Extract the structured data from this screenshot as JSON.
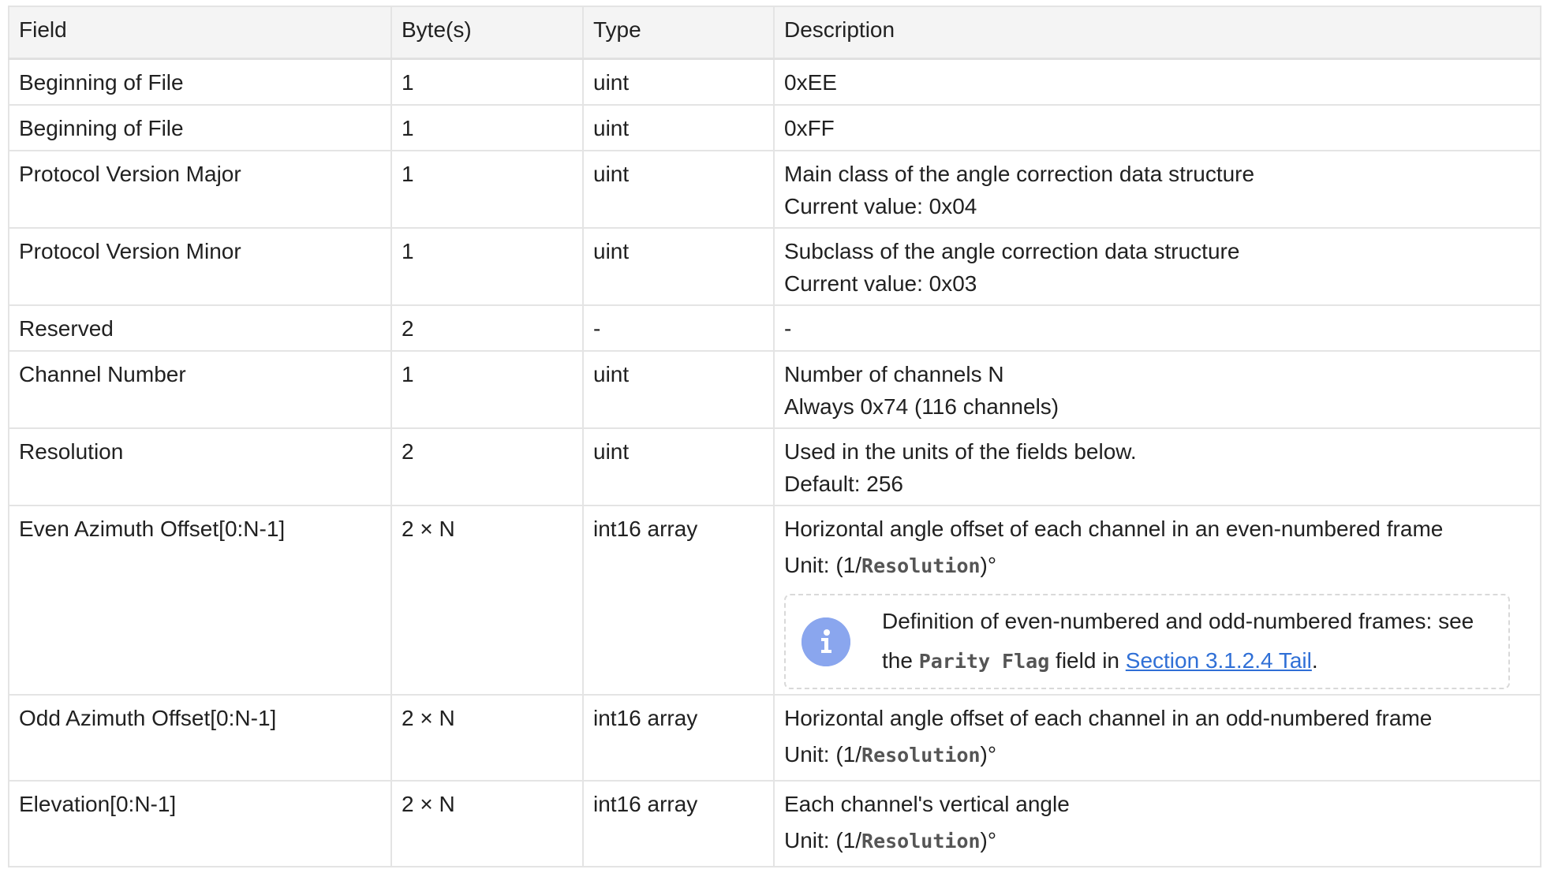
{
  "table": {
    "headers": [
      "Field",
      "Byte(s)",
      "Type",
      "Description"
    ],
    "rows": [
      {
        "field": "Beginning of File",
        "bytes": "1",
        "type": "uint",
        "desc": [
          "0xEE"
        ]
      },
      {
        "field": "Beginning of File",
        "bytes": "1",
        "type": "uint",
        "desc": [
          "0xFF"
        ]
      },
      {
        "field": "Protocol Version Major",
        "bytes": "1",
        "type": "uint",
        "desc": [
          "Main class of the angle correction data structure",
          "Current value: 0x04"
        ]
      },
      {
        "field": "Protocol Version Minor",
        "bytes": "1",
        "type": "uint",
        "desc": [
          "Subclass of the angle correction data structure",
          "Current value: 0x03"
        ]
      },
      {
        "field": "Reserved",
        "bytes": "2",
        "type": "-",
        "desc": [
          "-"
        ]
      },
      {
        "field": "Channel Number",
        "bytes": "1",
        "type": "uint",
        "desc": [
          "Number of channels N",
          "Always 0x74 (116 channels)"
        ]
      },
      {
        "field": "Resolution",
        "bytes": "2",
        "type": "uint",
        "desc": [
          "Used in the units of the fields below.",
          "Default: 256"
        ]
      },
      {
        "field": "Even Azimuth Offset[0:N-1]",
        "bytes": "2 × N",
        "type": "int16 array",
        "desc": [
          "Horizontal angle offset of each channel in an even-numbered frame"
        ],
        "unit": {
          "prefix": "Unit: (1/",
          "code": "Resolution",
          "suffix": ")°"
        }
      },
      {
        "field": "Odd Azimuth Offset[0:N-1]",
        "bytes": "2 × N",
        "type": "int16 array",
        "desc": [
          "Horizontal angle offset of each channel in an odd-numbered frame"
        ],
        "unit": {
          "prefix": "Unit: (1/",
          "code": "Resolution",
          "suffix": ")°"
        }
      },
      {
        "field": "Elevation[0:N-1]",
        "bytes": "2 × N",
        "type": "int16 array",
        "desc": [
          "Each channel's vertical angle"
        ],
        "unit": {
          "prefix": "Unit: (1/",
          "code": "Resolution",
          "suffix": ")°"
        }
      }
    ],
    "note": {
      "icon": "info-icon",
      "icon_color": "#8aa6ee",
      "text_before": "Definition of even-numbered and odd-numbered frames: see the ",
      "code": "Parity Flag",
      "text_middle": " field in ",
      "link": "Section 3.1.2.4 Tail",
      "text_after": "."
    }
  }
}
